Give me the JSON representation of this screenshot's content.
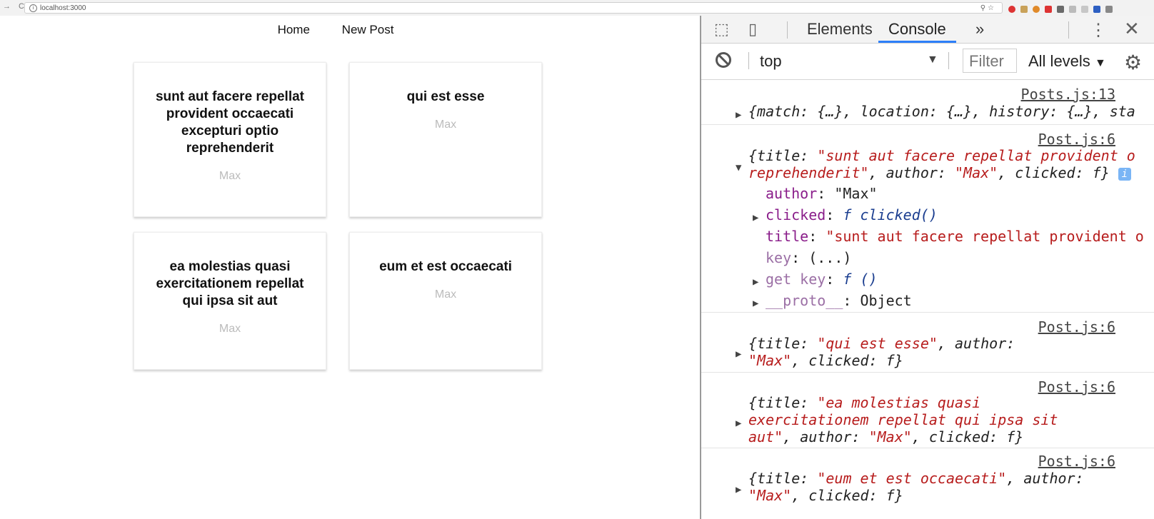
{
  "browser": {
    "url": "localhost:3000"
  },
  "nav": {
    "home": "Home",
    "new_post": "New Post"
  },
  "posts": [
    {
      "title": "sunt aut facere repellat provident occaecati excepturi optio reprehenderit",
      "author": "Max"
    },
    {
      "title": "qui est esse",
      "author": "Max"
    },
    {
      "title": "ea molestias quasi exercitationem repellat qui ipsa sit aut",
      "author": "Max"
    },
    {
      "title": "eum et est occaecati",
      "author": "Max"
    }
  ],
  "devtools": {
    "tabs": {
      "elements": "Elements",
      "console": "Console",
      "more": "»"
    },
    "context": "top",
    "filter_placeholder": "Filter",
    "levels": "All levels",
    "messages": {
      "m1": {
        "source": "Posts.js:13",
        "text": "{match: {…}, location: {…}, history: {…}, sta"
      },
      "m2": {
        "source": "Post.js:6",
        "line1_key": "{title: ",
        "line1_val": "\"sunt aut facere repellat provident o",
        "line2_val": "reprehenderit\"",
        "line2_rest": ", author: ",
        "line2_author": "\"Max\"",
        "line2_tail": ", clicked: f}",
        "author_key": "author",
        "author_val": "\"Max\"",
        "clicked_key": "clicked",
        "clicked_val": "f clicked()",
        "title_key": "title",
        "title_val": "\"sunt aut facere repellat provident o",
        "key_key": "key",
        "key_val": "(...)",
        "getkey_key": "get key",
        "getkey_val": "f ()",
        "proto_key": "__proto__",
        "proto_val": "Object"
      },
      "m3": {
        "source": "Post.js:6",
        "line1": "{title: ",
        "line1_val": "\"qui est esse\"",
        "line1_rest": ", author:",
        "line2_val": "\"Max\"",
        "line2_rest": ", clicked: f}"
      },
      "m4": {
        "source": "Post.js:6",
        "line1": "{title: ",
        "line1_val": "\"ea molestias quasi",
        "line2_val": "exercitationem repellat qui ipsa sit",
        "line3_val": "aut\"",
        "line3_rest": ", author: ",
        "line3_author": "\"Max\"",
        "line3_tail": ", clicked: f}"
      },
      "m5": {
        "source": "Post.js:6",
        "line1": "{title: ",
        "line1_val": "\"eum et est occaecati\"",
        "line1_rest": ", author:",
        "line2_val": "\"Max\"",
        "line2_rest": ", clicked: f}"
      }
    }
  }
}
